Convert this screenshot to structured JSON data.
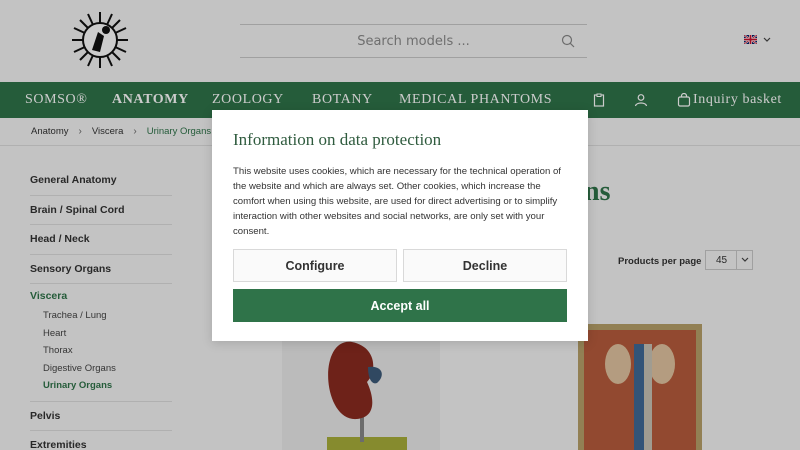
{
  "header": {
    "search_placeholder": "Search models ...",
    "language": "EN"
  },
  "nav": {
    "items": [
      "SOMSO®",
      "ANATOMY",
      "ZOOLOGY",
      "BOTANY",
      "MEDICAL PHANTOMS"
    ],
    "basket_label": "Inquiry basket"
  },
  "breadcrumb": [
    "Anatomy",
    "Viscera",
    "Urinary Organs"
  ],
  "sidebar": {
    "items": [
      "General Anatomy",
      "Brain / Spinal Cord",
      "Head / Neck",
      "Sensory Organs"
    ],
    "active": "Viscera",
    "sub_items": [
      "Trachea / Lung",
      "Heart",
      "Thorax",
      "Digestive Organs",
      "Urinary Organs"
    ],
    "after": [
      "Pelvis",
      "Extremities"
    ]
  },
  "main": {
    "title_fragment": "ns",
    "products_per_page_label": "Products per page",
    "products_per_page_value": "45"
  },
  "modal": {
    "title": "Information on data protection",
    "text": "This website uses cookies, which are necessary for the technical operation of the website and which are always set. Other cookies, which increase the comfort when using this website, are used for direct advertising or to simplify interaction with other websites and social networks, are only set with your consent.",
    "configure_label": "Configure",
    "decline_label": "Decline",
    "accept_label": "Accept all"
  },
  "colors": {
    "brand_green": "#2f7349",
    "background": "#f4f4f4"
  }
}
